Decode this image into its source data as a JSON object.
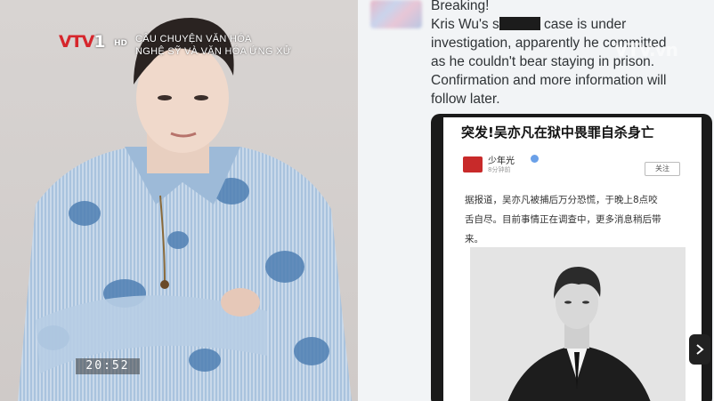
{
  "overlay": {
    "channel_logo_text": "VTV",
    "channel_logo_number": "1",
    "hd_label": "HD",
    "program_line1": "CÂU CHUYỆN VĂN HÓA",
    "program_line2": "NGHỆ SỸ VÀ VĂN HÓA ỨNG XỬ",
    "clock": "20:52"
  },
  "tweet": {
    "line1": "Breaking!",
    "line2_before": "Kris Wu's s",
    "line2_after": " case is under",
    "line3": "investigation, apparently he committed",
    "line4": "as he couldn't bear staying in prison.",
    "line5": "Confirmation and more information will",
    "line6": "follow later."
  },
  "embedded_post": {
    "headline": "突发!吴亦凡在狱中畏罪自杀身亡",
    "source_name": "少年光",
    "source_time": "8分钟前",
    "follow_label": "关注",
    "body_line1": "据报道，吴亦凡被捕后万分恐慌，于晚上8点咬",
    "body_line2": "舌自尽。目前事情正在调查中，更多消息稍后带",
    "body_line3": "来。"
  },
  "icons": {
    "scroll": "chevron-right-icon",
    "verified": "verified-badge-icon"
  },
  "colors": {
    "vtv_red": "#d6262c",
    "shirt_blue": "#8fb3d6",
    "tweet_text": "#2f3336",
    "card_frame": "#1a1a1a"
  }
}
